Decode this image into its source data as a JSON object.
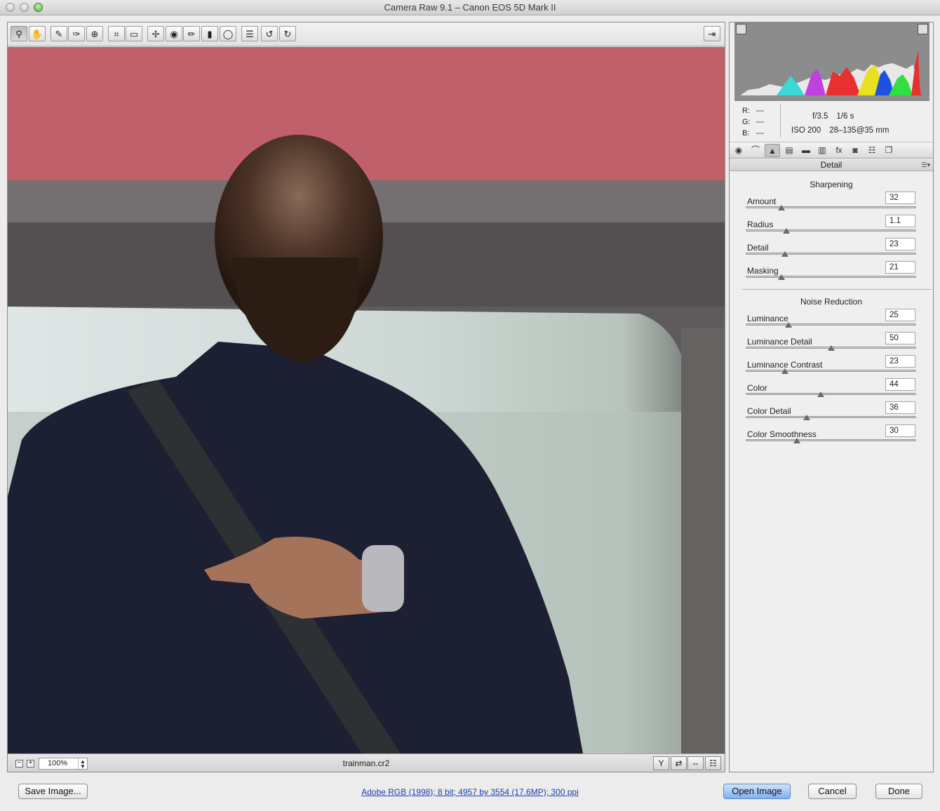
{
  "window": {
    "title": "Camera Raw 9.1  –  Canon EOS 5D Mark II"
  },
  "toolbar": {
    "tools": [
      {
        "name": "zoom-tool",
        "glyph": "⚲"
      },
      {
        "name": "hand-tool",
        "glyph": "✋"
      },
      {
        "name": "white-balance-tool",
        "glyph": "✎"
      },
      {
        "name": "color-sampler-tool",
        "glyph": "✑"
      },
      {
        "name": "targeted-adjustment-tool",
        "glyph": "⊕"
      },
      {
        "name": "crop-tool",
        "glyph": "⌗"
      },
      {
        "name": "straighten-tool",
        "glyph": "▭"
      },
      {
        "name": "spot-removal-tool",
        "glyph": "✢"
      },
      {
        "name": "red-eye-tool",
        "glyph": "◉"
      },
      {
        "name": "adjustment-brush-tool",
        "glyph": "✏"
      },
      {
        "name": "graduated-filter-tool",
        "glyph": "▮"
      },
      {
        "name": "radial-filter-tool",
        "glyph": "◯"
      },
      {
        "name": "preferences-tool",
        "glyph": "☰"
      },
      {
        "name": "rotate-ccw-tool",
        "glyph": "↺"
      },
      {
        "name": "rotate-cw-tool",
        "glyph": "↻"
      }
    ],
    "fullscreen_glyph": "⇥"
  },
  "status": {
    "zoom": "100%",
    "zoom_minus": "−",
    "zoom_plus": "+",
    "filename": "trainman.cr2"
  },
  "info": {
    "r_label": "R:",
    "r_value": "---",
    "g_label": "G:",
    "g_value": "---",
    "b_label": "B:",
    "b_value": "---",
    "aperture": "f/3.5",
    "shutter": "1/6 s",
    "iso": "ISO 200",
    "lens": "28–135@35 mm"
  },
  "panel": {
    "title": "Detail",
    "tabs": [
      "◉",
      "⌒",
      "▲",
      "▤",
      "▬",
      "▥",
      "fx",
      "◙",
      "☷",
      "❐"
    ],
    "sharpening": {
      "title": "Sharpening",
      "sliders": [
        {
          "label": "Amount",
          "value": "32",
          "pos": 0.21
        },
        {
          "label": "Radius",
          "value": "1.1",
          "pos": 0.24
        },
        {
          "label": "Detail",
          "value": "23",
          "pos": 0.23
        },
        {
          "label": "Masking",
          "value": "21",
          "pos": 0.21
        }
      ]
    },
    "noise": {
      "title": "Noise Reduction",
      "sliders": [
        {
          "label": "Luminance",
          "value": "25",
          "pos": 0.25
        },
        {
          "label": "Luminance Detail",
          "value": "50",
          "pos": 0.5
        },
        {
          "label": "Luminance Contrast",
          "value": "23",
          "pos": 0.23
        },
        {
          "label": "Color",
          "value": "44",
          "pos": 0.44
        },
        {
          "label": "Color Detail",
          "value": "36",
          "pos": 0.36
        },
        {
          "label": "Color Smoothness",
          "value": "30",
          "pos": 0.3
        }
      ]
    }
  },
  "footer": {
    "save": "Save Image...",
    "workflow": "Adobe RGB (1998); 8 bit; 4957 by 3554 (17.6MP); 300 ppi",
    "open": "Open Image",
    "cancel": "Cancel",
    "done": "Done"
  }
}
